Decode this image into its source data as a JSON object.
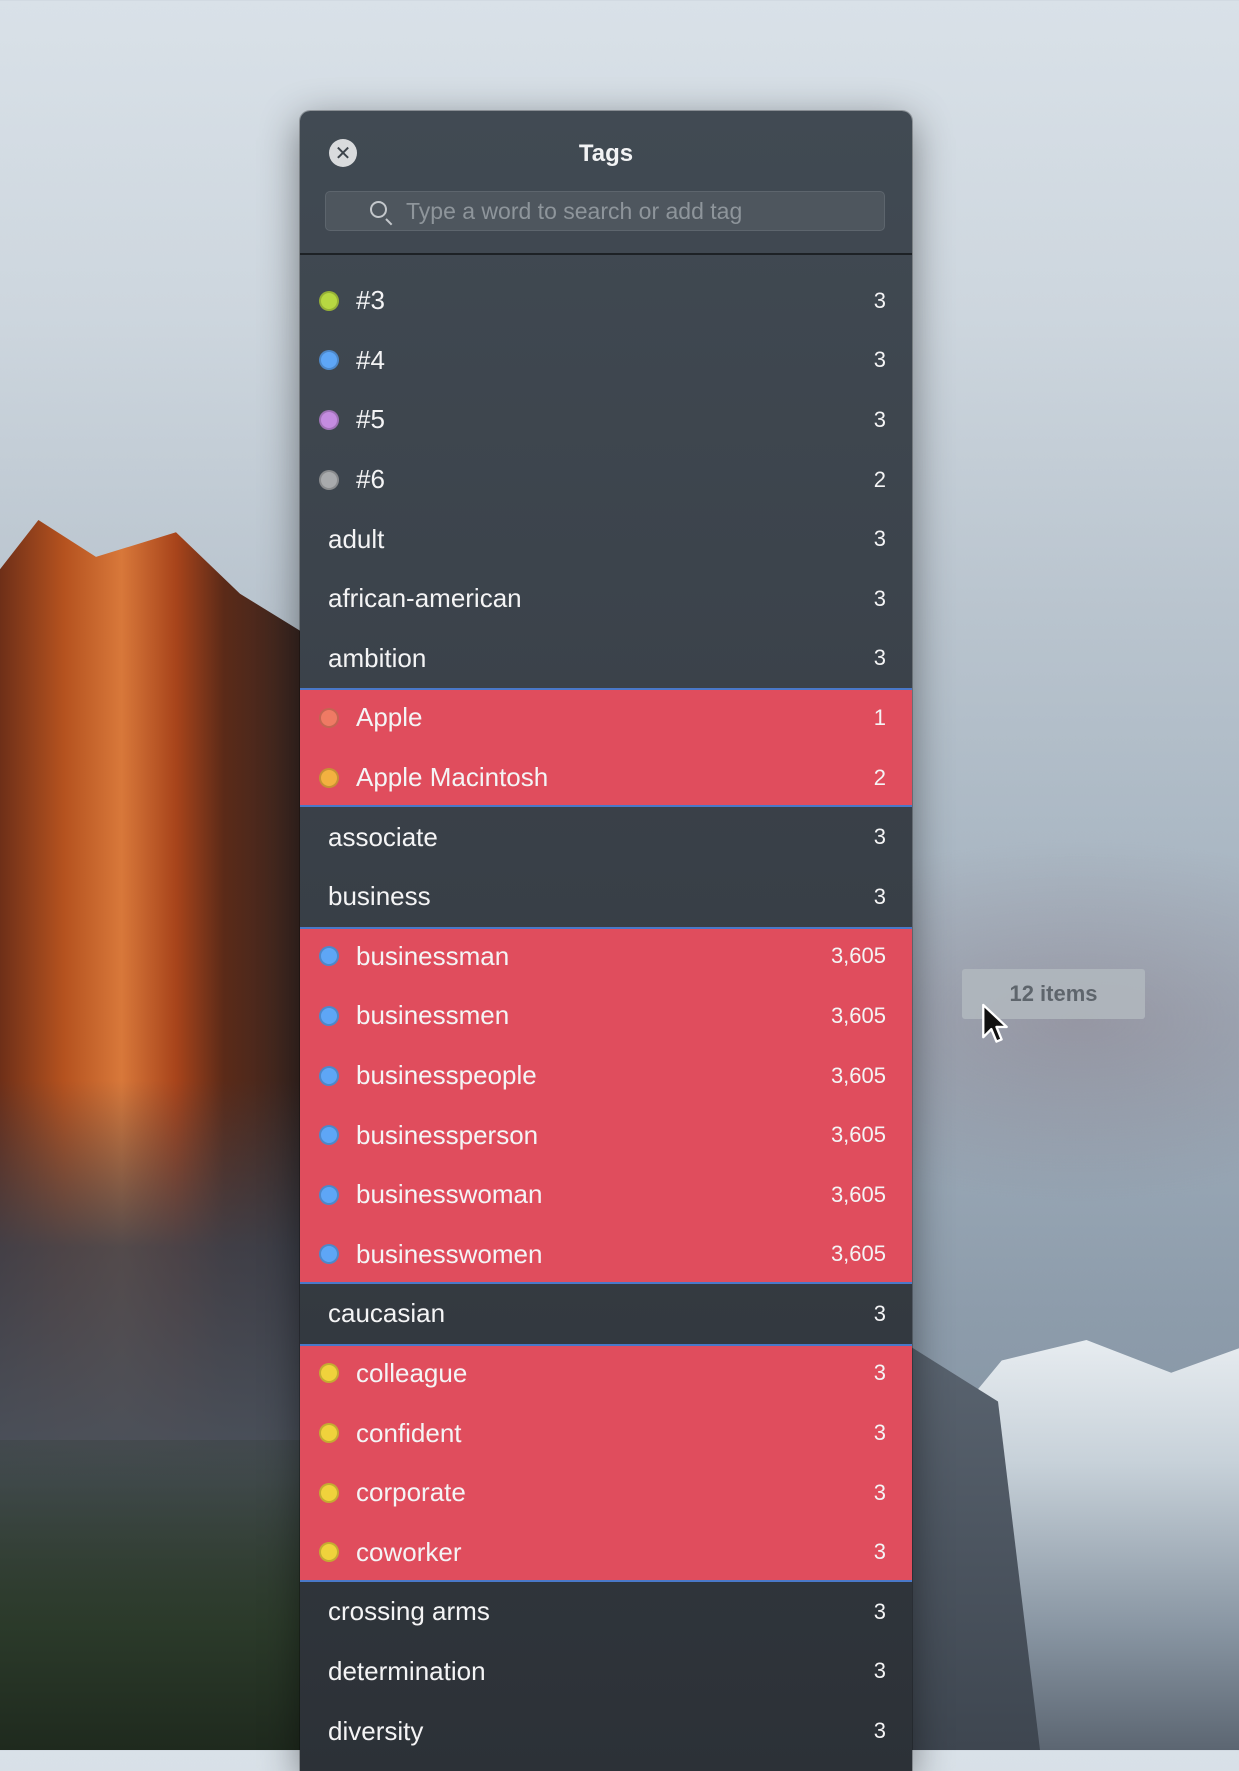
{
  "window": {
    "title": "Tags",
    "search_placeholder": "Type a word to search or add tag"
  },
  "tags": [
    {
      "name": "#3",
      "count": "3",
      "dot": "#b7d842",
      "selected": false
    },
    {
      "name": "#4",
      "count": "3",
      "dot": "#5ea6f6",
      "selected": false
    },
    {
      "name": "#5",
      "count": "3",
      "dot": "#c48ce0",
      "selected": false
    },
    {
      "name": "#6",
      "count": "2",
      "dot": "#a8aaac",
      "selected": false
    },
    {
      "name": "adult",
      "count": "3",
      "dot": null,
      "selected": false
    },
    {
      "name": "african-american",
      "count": "3",
      "dot": null,
      "selected": false
    },
    {
      "name": "ambition",
      "count": "3",
      "dot": null,
      "selected": false
    },
    {
      "name": "Apple",
      "count": "1",
      "dot": "#ef7a64",
      "selected": true
    },
    {
      "name": "Apple Macintosh",
      "count": "2",
      "dot": "#f3b140",
      "selected": true
    },
    {
      "name": "associate",
      "count": "3",
      "dot": null,
      "selected": false
    },
    {
      "name": "business",
      "count": "3",
      "dot": null,
      "selected": false
    },
    {
      "name": "businessman",
      "count": "3,605",
      "dot": "#5ea6f6",
      "selected": true
    },
    {
      "name": "businessmen",
      "count": "3,605",
      "dot": "#5ea6f6",
      "selected": true
    },
    {
      "name": "businesspeople",
      "count": "3,605",
      "dot": "#5ea6f6",
      "selected": true
    },
    {
      "name": "businessperson",
      "count": "3,605",
      "dot": "#5ea6f6",
      "selected": true
    },
    {
      "name": "businesswoman",
      "count": "3,605",
      "dot": "#5ea6f6",
      "selected": true
    },
    {
      "name": "businesswomen",
      "count": "3,605",
      "dot": "#5ea6f6",
      "selected": true
    },
    {
      "name": "caucasian",
      "count": "3",
      "dot": null,
      "selected": false
    },
    {
      "name": "colleague",
      "count": "3",
      "dot": "#f0d23c",
      "selected": true
    },
    {
      "name": "confident",
      "count": "3",
      "dot": "#f0d23c",
      "selected": true
    },
    {
      "name": "corporate",
      "count": "3",
      "dot": "#f0d23c",
      "selected": true
    },
    {
      "name": "coworker",
      "count": "3",
      "dot": "#f0d23c",
      "selected": true
    },
    {
      "name": "crossing arms",
      "count": "3",
      "dot": null,
      "selected": false
    },
    {
      "name": "determination",
      "count": "3",
      "dot": null,
      "selected": false
    },
    {
      "name": "diversity",
      "count": "3",
      "dot": null,
      "selected": false
    }
  ],
  "drag": {
    "label": "12 items"
  },
  "colors": {
    "selection": "#e04d5d",
    "selection_border": "#4a78c8",
    "panel": "#3a4149"
  },
  "icons": {
    "close": "close-icon",
    "search": "search-icon",
    "cursor": "arrow-cursor-icon"
  }
}
